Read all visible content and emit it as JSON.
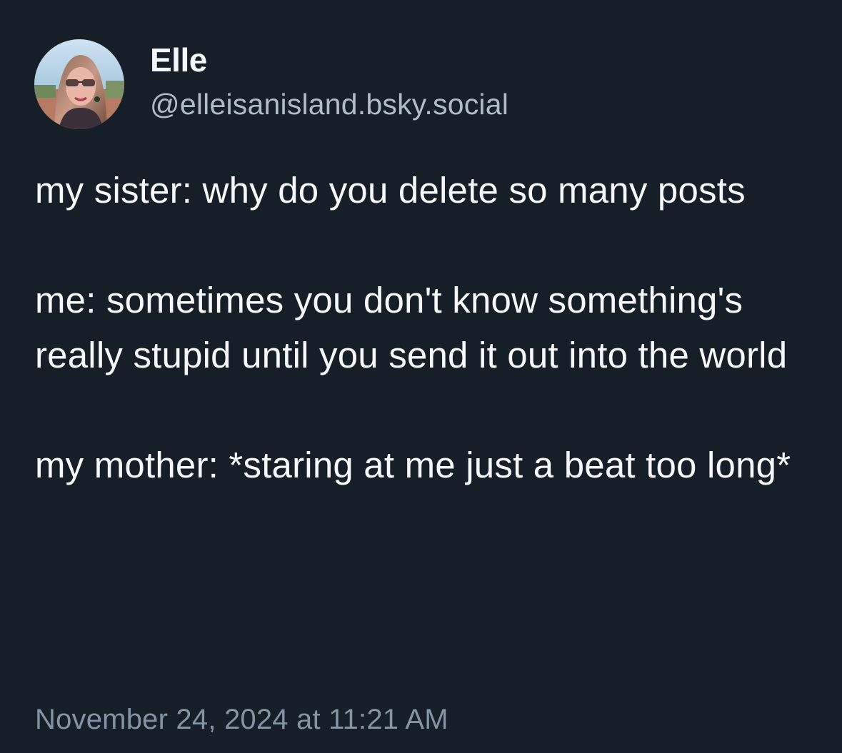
{
  "post": {
    "author": {
      "display_name": "Elle",
      "handle": "@elleisanisland.bsky.social"
    },
    "text": {
      "paragraph_1": "my sister: why do you delete so many posts",
      "paragraph_2": "me: sometimes you don't know something's really stupid until you send it out into the world",
      "paragraph_3": "my mother: *staring at me just a beat too long*"
    },
    "timestamp": "November 24, 2024 at 11:21 AM"
  },
  "colors": {
    "background": "#161e27",
    "text_primary": "#f6f7f8",
    "handle": "#b0bcc8",
    "timestamp": "#8494a4"
  }
}
